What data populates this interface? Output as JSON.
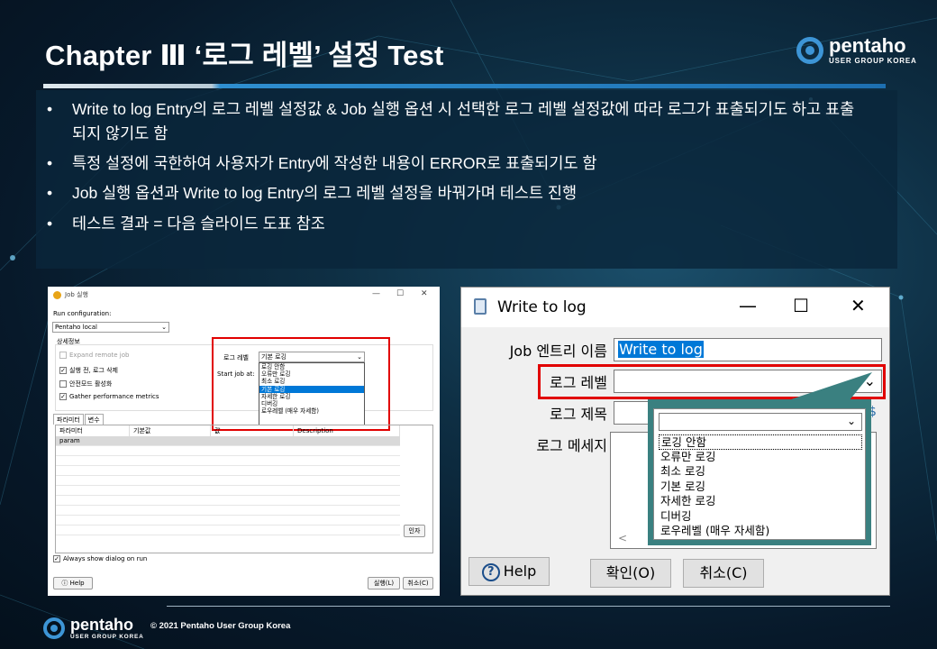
{
  "slide": {
    "title": "Chapter Ⅲ   ‘로그 레벨’ 설정 Test",
    "bullets": [
      "Write to log Entry의 로그 레벨 설정값 & Job 실행 옵션 시 선택한 로그 레벨 설정값에 따라 로그가 표출되기도 하고 표출되지 않기도 함",
      "특정 설정에 국한하여 사용자가 Entry에 작성한 내용이 ERROR로 표출되기도 함",
      "Job 실행 옵션과 Write to log Entry의 로그 레벨 설정을 바꿔가며 테스트 진행",
      "테스트 결과 = 다음 슬라이드 도표 참조"
    ],
    "copyright": "© 2021 Pentaho User Group Korea",
    "accent_color": "#2f8fd0",
    "highlight_color": "#e10000"
  },
  "logo": {
    "name": "pentaho",
    "sub": "USER GROUP KOREA"
  },
  "job_dialog": {
    "title": "Job 실행",
    "run_config_label": "Run configuration:",
    "run_config_value": "Pentaho local",
    "details_label": "상세정보",
    "checks": [
      {
        "label": "Expand remote job",
        "checked": false,
        "disabled": true
      },
      {
        "label": "실행 전, 로그 삭제",
        "checked": true,
        "disabled": false
      },
      {
        "label": "안전모드 활성화",
        "checked": false,
        "disabled": false
      },
      {
        "label": "Gather performance metrics",
        "checked": true,
        "disabled": false
      }
    ],
    "log_level_label": "로그 레벨",
    "log_level_value": "기본 로깅",
    "start_job_label": "Start job at:",
    "log_options": [
      "로깅 안함",
      "오류만 로깅",
      "최소 로깅",
      "기본 로깅",
      "자세한 로깅",
      "디버깅",
      "로우레벨 (매우 자세함)"
    ],
    "selected_option": "기본 로깅",
    "tabs": [
      "파라미터",
      "변수"
    ],
    "columns": [
      "파라미터",
      "기본값",
      "값",
      "Description"
    ],
    "rows": [
      [
        "param",
        "",
        "",
        ""
      ]
    ],
    "args_button": "인자",
    "always_show": "Always show dialog on run",
    "help_button": "Help",
    "run_button": "실행(L)",
    "cancel_button": "취소(C)"
  },
  "write_log_dialog": {
    "title": "Write to log",
    "entry_name_label": "Job 엔트리 이름",
    "entry_name_value": "Write to log",
    "log_level_label": "로그 레벨",
    "log_title_label": "로그 제목",
    "log_message_label": "로그 메세지",
    "log_options": [
      "로깅 안함",
      "오류만 로깅",
      "최소 로깅",
      "기본 로깅",
      "자세한 로깅",
      "디버깅",
      "로우레벨 (매우 자세함)"
    ],
    "help_button": "Help",
    "ok_button": "확인(O)",
    "cancel_button": "취소(C)"
  }
}
